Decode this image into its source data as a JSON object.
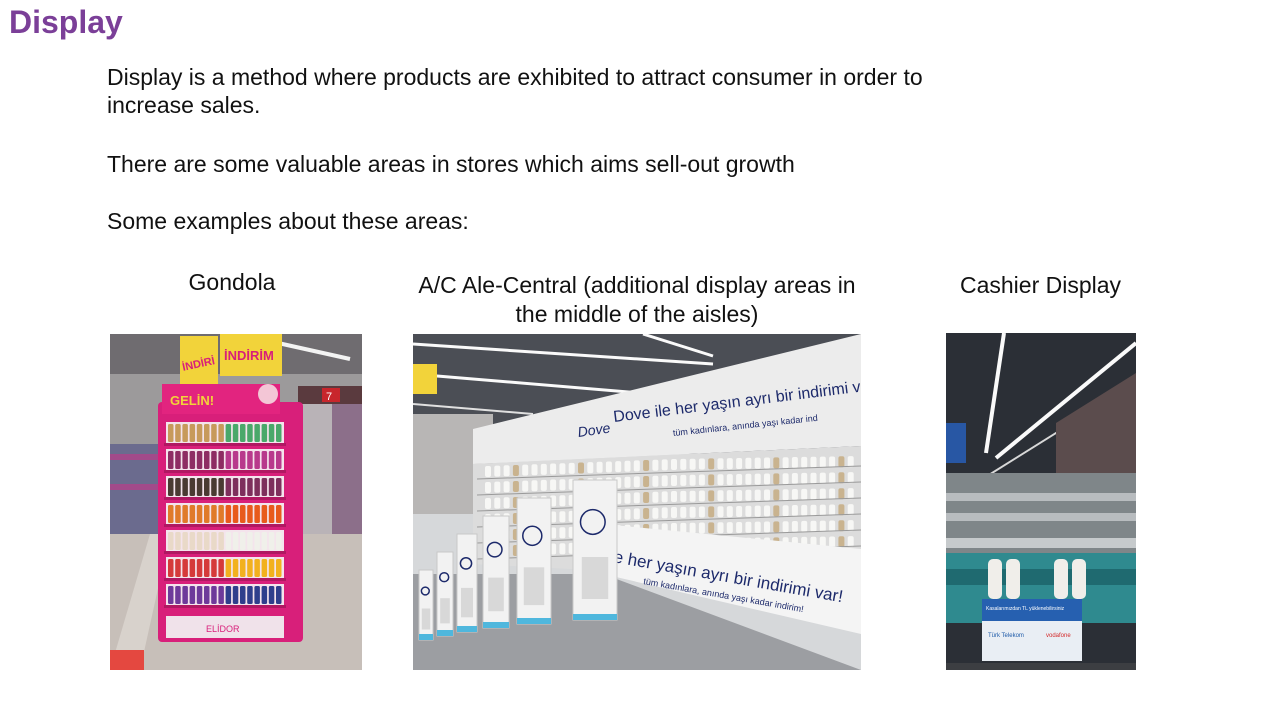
{
  "slide": {
    "title": "Display",
    "paragraphs": [
      "Display is a method where products are exhibited to attract consumer in order to increase sales.",
      "There are some valuable areas in stores which aims sell-out growth",
      "Some examples about these areas:"
    ]
  },
  "examples": [
    {
      "caption": "Gondola",
      "photo_texts": {
        "sign_left": "İNDİRİ",
        "sign_right": "İNDİRİM",
        "header": "GELİN!",
        "base_brand": "ELİDOR",
        "aisle_number": "7"
      }
    },
    {
      "caption": "A/C Ale-Central (additional display areas in the middle of the aisles)",
      "photo_texts": {
        "banner": "Dove ile her yaşın ayrı bir indirimi v",
        "banner_sub": "tüm kadınlara, anında yaşı kadar ind",
        "brand": "Dove",
        "lower_banner": "e her yaşın ayrı bir indirimi var!",
        "lower_sub": "tüm kadınlara, anında yaşı kadar indirim!"
      }
    },
    {
      "caption": "Cashier Display",
      "photo_texts": {
        "sign": "Kasalarımızdan TL yüklenebilirsiniz",
        "brand_left": "Türk Telekom",
        "brand_right": "vodafone"
      }
    }
  ],
  "colors": {
    "title": "#7b3f98",
    "gondola_pink": "#d81f7a",
    "dove_navy": "#1d2a6b"
  }
}
